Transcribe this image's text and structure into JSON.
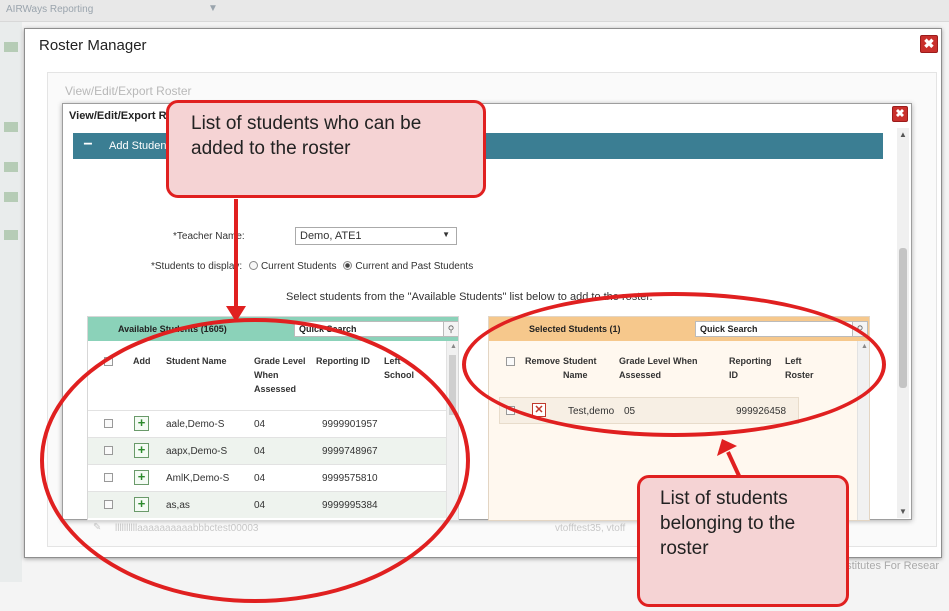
{
  "background_app": {
    "title": "AIRWays Reporting",
    "caret": "▼",
    "footer_text": "nstitutes For Resear"
  },
  "outer_modal": {
    "title": "Roster Manager",
    "subtitle": "View/Edit/Export Roster",
    "close_glyph": "✖",
    "footer_row": {
      "pencil": "✎",
      "text_left": "llllllllllaaaaaaaaaabbbctest00003",
      "text_right": "vtofftest35, vtoff"
    }
  },
  "inner_modal": {
    "title": "View/Edit/Export R",
    "close_glyph": "✖",
    "section_label": "Add Studen",
    "section_toggle": "−",
    "teacher_label": "*Teacher Name:",
    "teacher_value": "Demo, ATE1",
    "students_label": "*Students to display:",
    "radio_current": "Current Students",
    "radio_past": "Current and Past Students",
    "instructions": "Select students from the \"Available Students\" list below to add to the roster."
  },
  "available": {
    "title": "Available Students (1605)",
    "search_placeholder": "Quick Search",
    "search_icon": "magnifier-icon",
    "headers": {
      "add": "Add",
      "name": "Student Name",
      "grade": "Grade Level When Assessed",
      "reporting": "Reporting ID",
      "left": "Left School"
    },
    "rows": [
      {
        "name": "aale,Demo-S",
        "grade": "04",
        "id": "9999901957"
      },
      {
        "name": "aapx,Demo-S",
        "grade": "04",
        "id": "9999748967"
      },
      {
        "name": "AmlK,Demo-S",
        "grade": "04",
        "id": "9999575810"
      },
      {
        "name": "as,as",
        "grade": "04",
        "id": "9999995384"
      }
    ]
  },
  "selected": {
    "title": "Selected Students (1)",
    "search_placeholder": "Quick Search",
    "headers": {
      "remove": "Remove",
      "name": "Student Name",
      "grade": "Grade Level When Assessed",
      "reporting": "Reporting ID",
      "left": "Left Roster"
    },
    "rows": [
      {
        "name": "Test,demo",
        "grade": "05",
        "id": "999926458"
      }
    ]
  },
  "callouts": {
    "available_note": "List of students who can be added to the roster",
    "selected_note": "List of students belonging to the roster"
  },
  "colors": {
    "annotation_red": "#e02020",
    "callout_fill": "#f5d3d4",
    "section_bar": "#3b7e93",
    "available_header": "#8bd2b9",
    "selected_header": "#f6c88c"
  }
}
